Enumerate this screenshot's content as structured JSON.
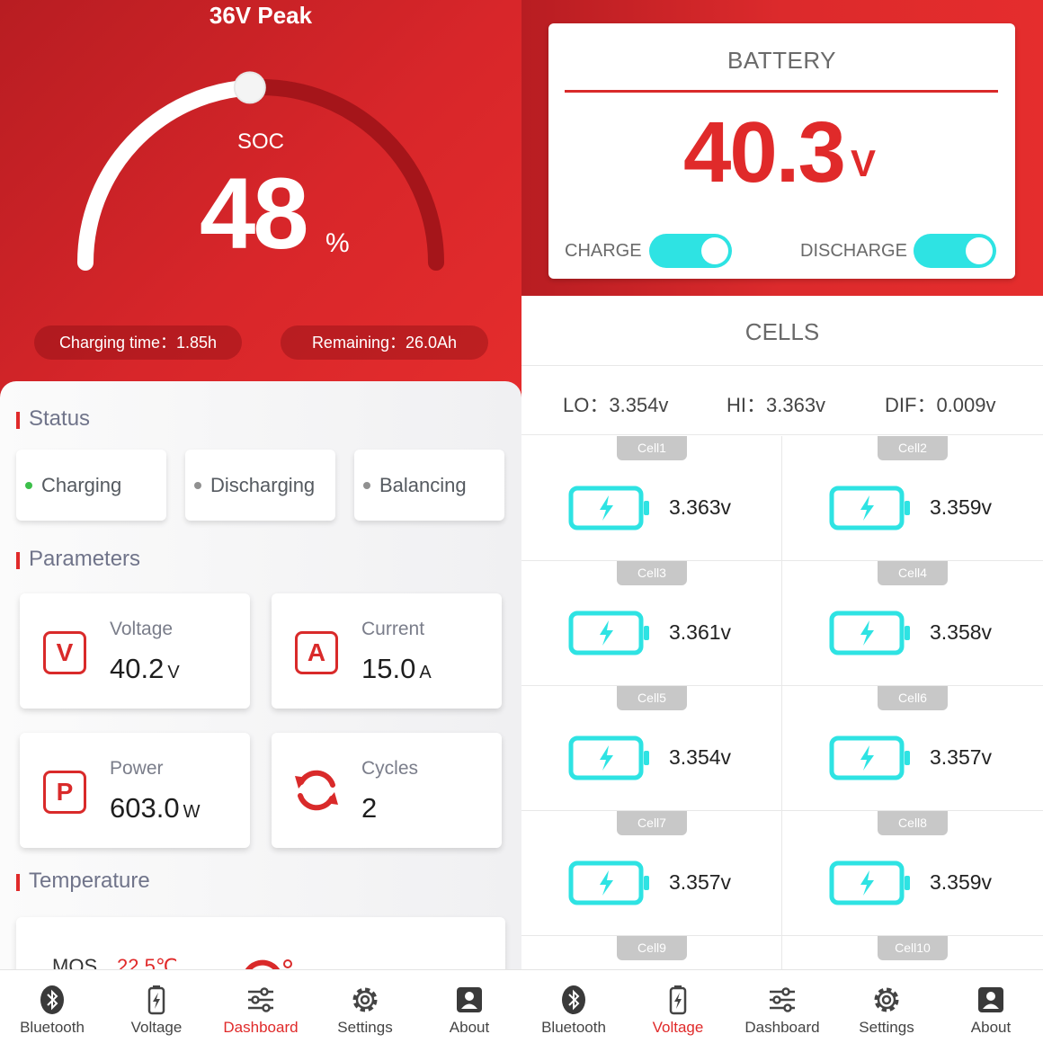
{
  "left": {
    "title": "36V Peak",
    "soc": {
      "label": "SOC",
      "value": "48",
      "unit": "%",
      "fraction": 0.48
    },
    "pills": {
      "charging_time": "Charging time：1.85h",
      "remaining": "Remaining：26.0Ah"
    },
    "status": {
      "title": "Status",
      "items": [
        {
          "label": "Charging",
          "active": true
        },
        {
          "label": "Discharging",
          "active": false
        },
        {
          "label": "Balancing",
          "active": false
        }
      ]
    },
    "parameters": {
      "title": "Parameters",
      "voltage": {
        "icon": "V",
        "label": "Voltage",
        "value": "40.2",
        "unit": "V"
      },
      "current": {
        "icon": "A",
        "label": "Current",
        "value": "15.0",
        "unit": "A"
      },
      "power": {
        "icon": "P",
        "label": "Power",
        "value": "603.0",
        "unit": "W"
      },
      "cycles": {
        "label": "Cycles",
        "value": "2"
      }
    },
    "temperature": {
      "title": "Temperature",
      "mos_label": "MOS",
      "mos_value": "22.5℃"
    },
    "nav": [
      {
        "label": "Bluetooth",
        "icon": "bluetooth-icon"
      },
      {
        "label": "Voltage",
        "icon": "battery-charging-icon"
      },
      {
        "label": "Dashboard",
        "icon": "sliders-icon",
        "active": true
      },
      {
        "label": "Settings",
        "icon": "gear-icon"
      },
      {
        "label": "About",
        "icon": "user-icon"
      }
    ]
  },
  "right": {
    "battery": {
      "title": "BATTERY",
      "voltage": "40.3",
      "unit": "V",
      "charge_label": "CHARGE",
      "discharge_label": "DISCHARGE",
      "charge_on": true,
      "discharge_on": true
    },
    "cells": {
      "title": "CELLS",
      "lo": "LO：3.354v",
      "hi": "HI：3.363v",
      "dif": "DIF：0.009v",
      "items": [
        {
          "name": "Cell1",
          "voltage": "3.363v"
        },
        {
          "name": "Cell2",
          "voltage": "3.359v"
        },
        {
          "name": "Cell3",
          "voltage": "3.361v"
        },
        {
          "name": "Cell4",
          "voltage": "3.358v"
        },
        {
          "name": "Cell5",
          "voltage": "3.354v"
        },
        {
          "name": "Cell6",
          "voltage": "3.357v"
        },
        {
          "name": "Cell7",
          "voltage": "3.357v"
        },
        {
          "name": "Cell8",
          "voltage": "3.359v"
        },
        {
          "name": "Cell9",
          "voltage": ""
        },
        {
          "name": "Cell10",
          "voltage": ""
        }
      ]
    },
    "nav": [
      {
        "label": "Bluetooth",
        "icon": "bluetooth-icon"
      },
      {
        "label": "Voltage",
        "icon": "battery-charging-icon",
        "active": true
      },
      {
        "label": "Dashboard",
        "icon": "sliders-icon"
      },
      {
        "label": "Settings",
        "icon": "gear-icon"
      },
      {
        "label": "About",
        "icon": "user-icon"
      }
    ]
  },
  "colors": {
    "accent_red": "#e02a2a",
    "toggle_cyan": "#2ee3e3",
    "charging_green": "#3cbf4a"
  }
}
